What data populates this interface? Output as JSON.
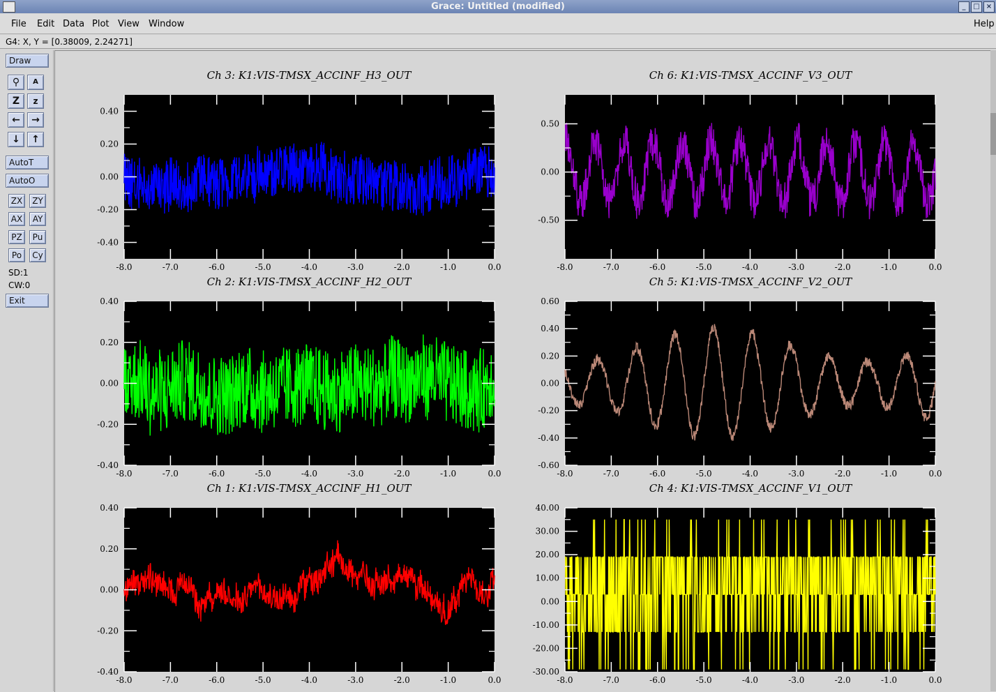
{
  "window": {
    "title": "Grace: Untitled (modified)"
  },
  "menubar": {
    "file": "File",
    "edit": "Edit",
    "data": "Data",
    "plot": "Plot",
    "view": "View",
    "window": "Window",
    "help": "Help"
  },
  "coordbar": {
    "text": "G4: X, Y = [0.38009, 2.24271]"
  },
  "toolpanel": {
    "draw": "Draw",
    "autot": "AutoT",
    "autoo": "AutoO",
    "zx": "ZX",
    "zy": "ZY",
    "ax": "AX",
    "ay": "AY",
    "pz": "PZ",
    "pu": "Pu",
    "po": "Po",
    "cy": "Cy",
    "sd": "SD:1",
    "cw": "CW:0",
    "exit": "Exit"
  },
  "chart_data": [
    {
      "type": "line",
      "title": "Ch 3:  K1:VIS-TMSX_ACCINF_H3_OUT",
      "color": "#0000ff",
      "xlim": [
        -8.0,
        0.0
      ],
      "ylim": [
        -0.5,
        0.5
      ],
      "yticks": [
        -0.4,
        -0.2,
        0.0,
        0.2,
        0.4
      ],
      "ytick_labels": [
        "-0.40",
        "-0.20",
        "0.00",
        "0.20",
        "0.40"
      ],
      "xtick_labels": [
        "-8.0",
        "-7.0",
        "-6.0",
        "-5.0",
        "-4.0",
        "-3.0",
        "-2.0",
        "-1.0",
        "0.0"
      ],
      "amplitude": 0.16,
      "style": "noise"
    },
    {
      "type": "line",
      "title": "Ch 6:  K1:VIS-TMSX_ACCINF_V3_OUT",
      "color": "#9900cc",
      "xlim": [
        -8.0,
        0.0
      ],
      "ylim": [
        -0.9,
        0.8
      ],
      "yticks": [
        -0.5,
        0.0,
        0.5
      ],
      "ytick_labels": [
        "-0.50",
        "0.00",
        "0.50"
      ],
      "xtick_labels": [
        "-8.0",
        "-7.0",
        "-6.0",
        "-5.0",
        "-4.0",
        "-3.0",
        "-2.0",
        "-1.0",
        "0.0"
      ],
      "amplitude": 0.45,
      "style": "oscillation"
    },
    {
      "type": "line",
      "title": "Ch 2:  K1:VIS-TMSX_ACCINF_H2_OUT",
      "color": "#00ff00",
      "xlim": [
        -8.0,
        0.0
      ],
      "ylim": [
        -0.4,
        0.4
      ],
      "yticks": [
        -0.4,
        -0.2,
        0.0,
        0.2,
        0.4
      ],
      "ytick_labels": [
        "-0.40",
        "-0.20",
        "0.00",
        "0.20",
        "0.40"
      ],
      "xtick_labels": [
        "-8.0",
        "-7.0",
        "-6.0",
        "-5.0",
        "-4.0",
        "-3.0",
        "-2.0",
        "-1.0",
        "0.0"
      ],
      "amplitude": 0.2,
      "style": "noise"
    },
    {
      "type": "line",
      "title": "Ch 5:  K1:VIS-TMSX_ACCINF_V2_OUT",
      "color": "#bb8877",
      "xlim": [
        -8.0,
        0.0
      ],
      "ylim": [
        -0.6,
        0.6
      ],
      "yticks": [
        -0.6,
        -0.4,
        -0.2,
        0.0,
        0.2,
        0.4,
        0.6
      ],
      "ytick_labels": [
        "-0.60",
        "-0.40",
        "-0.20",
        "0.00",
        "0.20",
        "0.40",
        "0.60"
      ],
      "xtick_labels": [
        "-8.0",
        "-7.0",
        "-6.0",
        "-5.0",
        "-4.0",
        "-3.0",
        "-2.0",
        "-1.0",
        "0.0"
      ],
      "amplitude": 0.4,
      "style": "sine"
    },
    {
      "type": "line",
      "title": "Ch 1:  K1:VIS-TMSX_ACCINF_H1_OUT",
      "color": "#ff0000",
      "xlim": [
        -8.0,
        0.0
      ],
      "ylim": [
        -0.4,
        0.4
      ],
      "yticks": [
        -0.4,
        -0.2,
        0.0,
        0.2,
        0.4
      ],
      "ytick_labels": [
        "-0.40",
        "-0.20",
        "0.00",
        "0.20",
        "0.40"
      ],
      "xtick_labels": [
        "-8.0",
        "-7.0",
        "-6.0",
        "-5.0",
        "-4.0",
        "-3.0",
        "-2.0",
        "-1.0",
        "0.0"
      ],
      "amplitude": 0.12,
      "style": "wander"
    },
    {
      "type": "line",
      "title": "Ch 4:  K1:VIS-TMSX_ACCINF_V1_OUT",
      "color": "#ffff00",
      "xlim": [
        -8.0,
        0.0
      ],
      "ylim": [
        -30.0,
        40.0
      ],
      "yticks": [
        -30,
        -20,
        -10,
        0,
        10,
        20,
        30,
        40
      ],
      "ytick_labels": [
        "-30.00",
        "-20.00",
        "-10.00",
        "0.00",
        "10.00",
        "20.00",
        "30.00",
        "40.00"
      ],
      "xtick_labels": [
        "-8.0",
        "-7.0",
        "-6.0",
        "-5.0",
        "-4.0",
        "-3.0",
        "-2.0",
        "-1.0",
        "0.0"
      ],
      "levels": [
        -29,
        -13,
        3,
        19,
        35
      ],
      "style": "digital"
    }
  ]
}
